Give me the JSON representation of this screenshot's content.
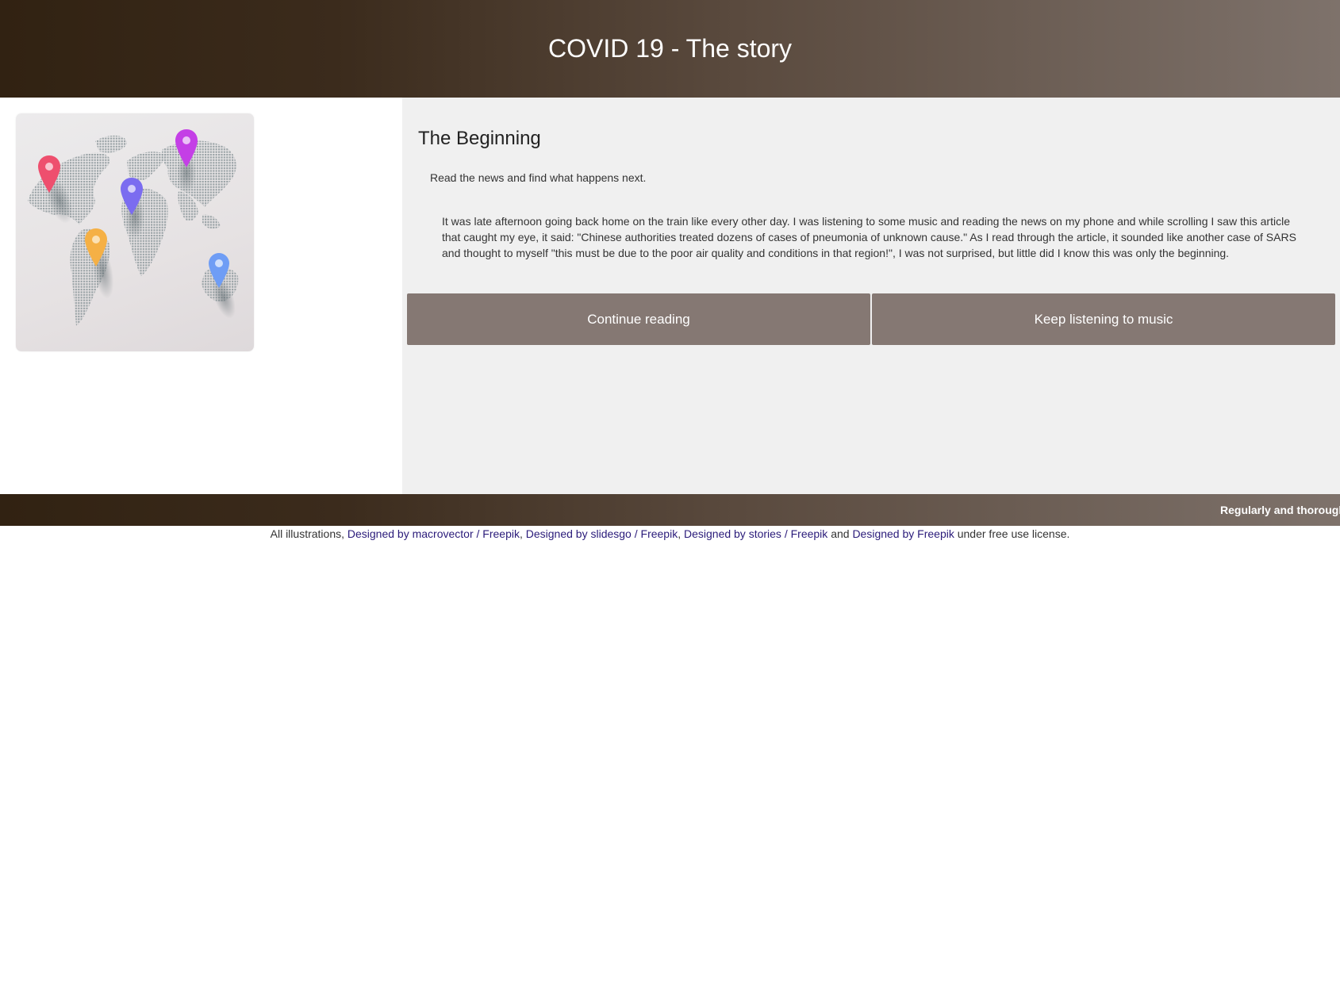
{
  "header": {
    "title": "COVID 19 - The story"
  },
  "illustration": {
    "icon": "world-map-with-location-pins",
    "pin_colors": [
      "#ee4f6e",
      "#c43fe6",
      "#7b6cf0",
      "#f5b045",
      "#6f9df5"
    ]
  },
  "story": {
    "title": "The Beginning",
    "subtitle": "Read the news and find what happens next.",
    "text": "It was late afternoon going back home on the train like every other day. I was listening to some music and reading the news on my phone and while scrolling I saw this article that caught my eye, it said: \"Chinese authorities treated dozens of cases of pneumonia of unknown cause.\" As I read through the article, it sounded like another case of SARS and thought to myself \"this must be due to the poor air quality and conditions in that region!\", I was not surprised, but little did I know this was only the beginning."
  },
  "choices": {
    "continue_label": "Continue reading",
    "music_label": "Keep listening to music"
  },
  "footer": {
    "marquee": "Regularly and thoroughly",
    "credits": {
      "prefix": "All illustrations,",
      "link1": "Designed by macrovector / Freepik",
      "sep1": ",",
      "link2": "Designed by slidesgo / Freepik",
      "sep2": ",",
      "link3": "Designed by stories / Freepik",
      "and": "and",
      "link4": "Designed by Freepik",
      "suffix": "under free use license."
    }
  },
  "colors": {
    "header_dark": "#312212",
    "header_light": "#7e726b",
    "button": "#857873",
    "panel": "#f0f0f0",
    "link": "#2a1b7a"
  }
}
